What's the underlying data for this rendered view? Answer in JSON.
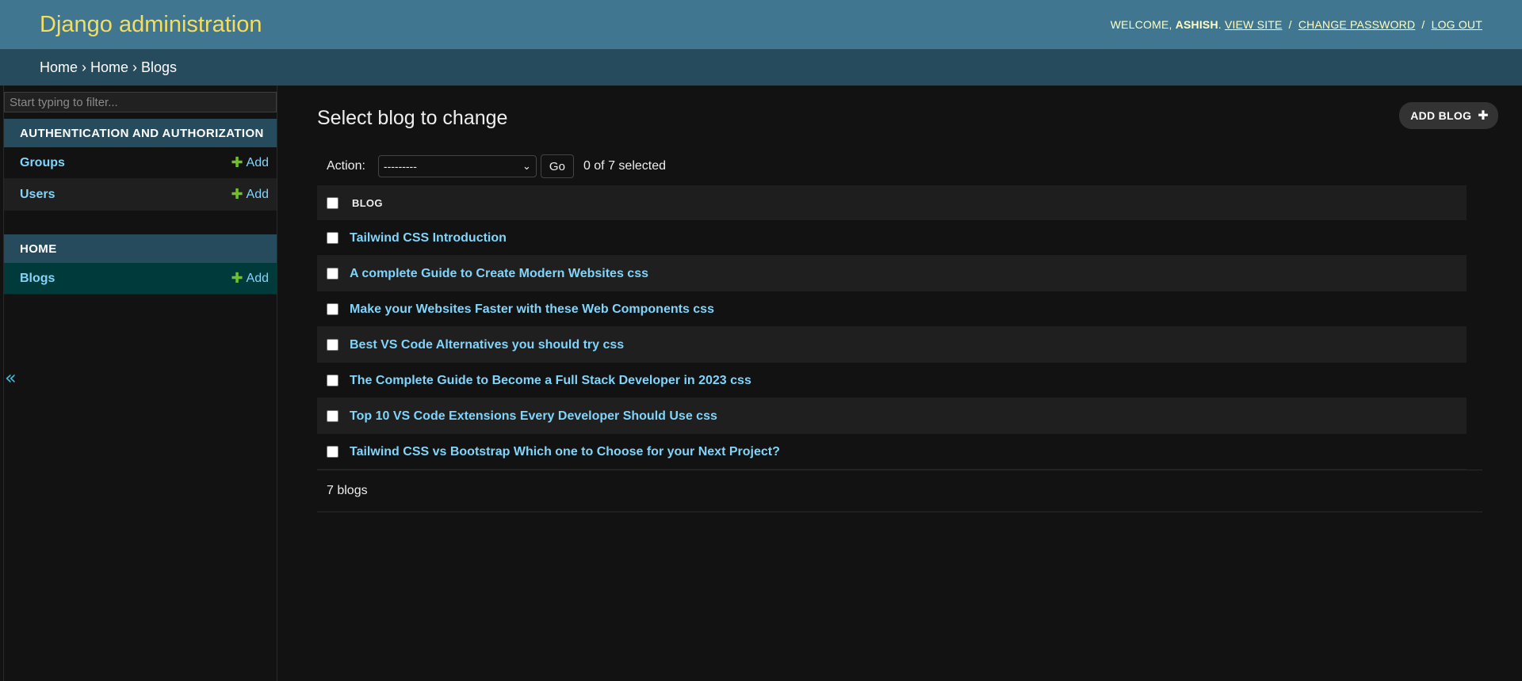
{
  "header": {
    "brand": "Django administration",
    "welcome": "Welcome,",
    "username": "ashish",
    "view_site": "View site",
    "change_password": "Change password",
    "log_out": "Log out",
    "sep": "/"
  },
  "breadcrumbs": {
    "items": [
      "Home",
      "Home"
    ],
    "current": "Blogs",
    "separator": "›"
  },
  "sidebar": {
    "filter_placeholder": "Start typing to filter...",
    "toggle": "«",
    "modules": [
      {
        "caption": "Authentication and Authorization",
        "models": [
          {
            "name": "Groups",
            "add": "Add"
          },
          {
            "name": "Users",
            "add": "Add"
          }
        ]
      },
      {
        "caption": "Home",
        "models": [
          {
            "name": "Blogs",
            "add": "Add"
          }
        ]
      }
    ]
  },
  "content": {
    "title": "Select blog to change",
    "add_button": "Add blog",
    "action_label": "Action:",
    "action_selected": "---------",
    "go": "Go",
    "selected_count": "0 of 7 selected",
    "column_header": "Blog",
    "rows": [
      "Tailwind CSS Introduction",
      "A complete Guide to Create Modern Websites css",
      "Make your Websites Faster with these Web Components css",
      "Best VS Code Alternatives you should try css",
      "The Complete Guide to Become a Full Stack Developer in 2023 css",
      "Top 10 VS Code Extensions Every Developer Should Use css",
      "Tailwind CSS vs Bootstrap Which one to Choose for your Next Project?"
    ],
    "paginator": "7 blogs"
  },
  "colors": {
    "header_bg": "#417690",
    "breadcrumb_bg": "#264b5d",
    "brand": "#f5dd5d",
    "link": "#81d4fa",
    "add_plus": "#70bf2b",
    "current_row": "#003a3a"
  },
  "icons": {
    "plus": "plus-icon",
    "chevron": "chevron-down-icon",
    "collapse": "collapse-sidebar-icon"
  }
}
